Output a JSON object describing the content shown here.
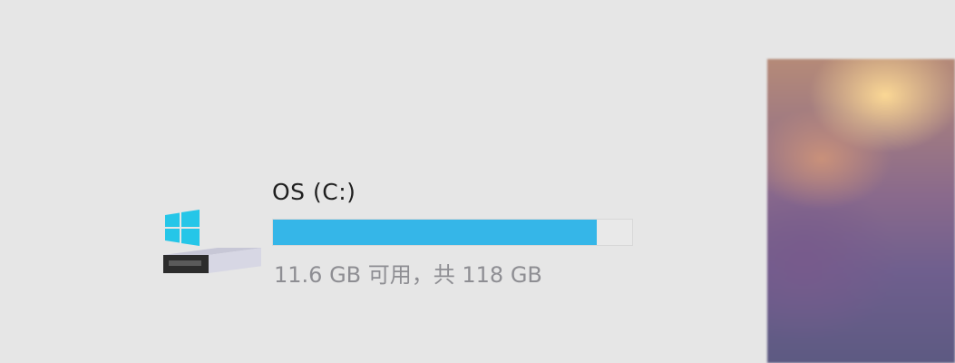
{
  "drive": {
    "icon": "windows-system-drive-icon",
    "name": "OS (C:)",
    "space_text": "11.6 GB 可用，共 118 GB",
    "used_fraction": 0.902,
    "bar_color": "#35b6e8"
  },
  "wallpaper": {
    "description_icon": "desktop-wallpaper-thumbnail"
  }
}
